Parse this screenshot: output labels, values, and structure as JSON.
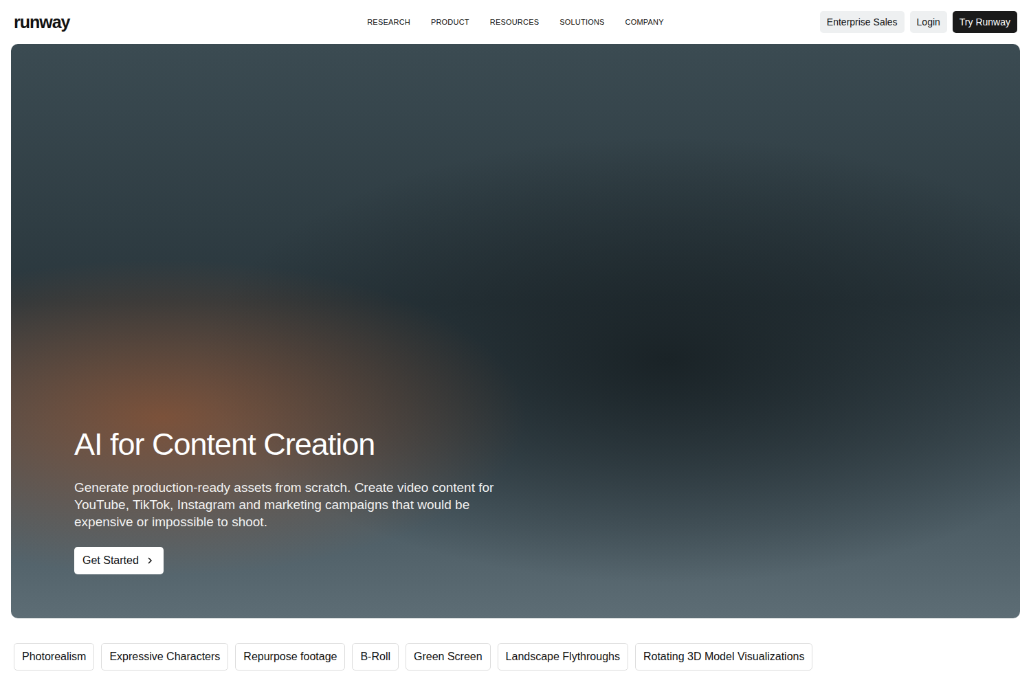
{
  "nav": {
    "logo": "runway",
    "links": [
      "RESEARCH",
      "PRODUCT",
      "RESOURCES",
      "SOLUTIONS",
      "COMPANY"
    ],
    "actions": [
      {
        "label": "Enterprise Sales",
        "kind": "secondary"
      },
      {
        "label": "Login",
        "kind": "secondary"
      },
      {
        "label": "Try Runway",
        "kind": "primary"
      }
    ]
  },
  "hero": {
    "title": "AI for Content Creation",
    "description": "Generate production-ready assets from scratch. Create video content for YouTube, TikTok, Instagram and marketing campaigns that would be expensive or impossible to shoot.",
    "cta": "Get Started"
  },
  "chips": [
    "Photorealism",
    "Expressive Characters",
    "Repurpose footage",
    "B-Roll",
    "Green Screen",
    "Landscape Flythroughs",
    "Rotating 3D Model Visualizations"
  ]
}
